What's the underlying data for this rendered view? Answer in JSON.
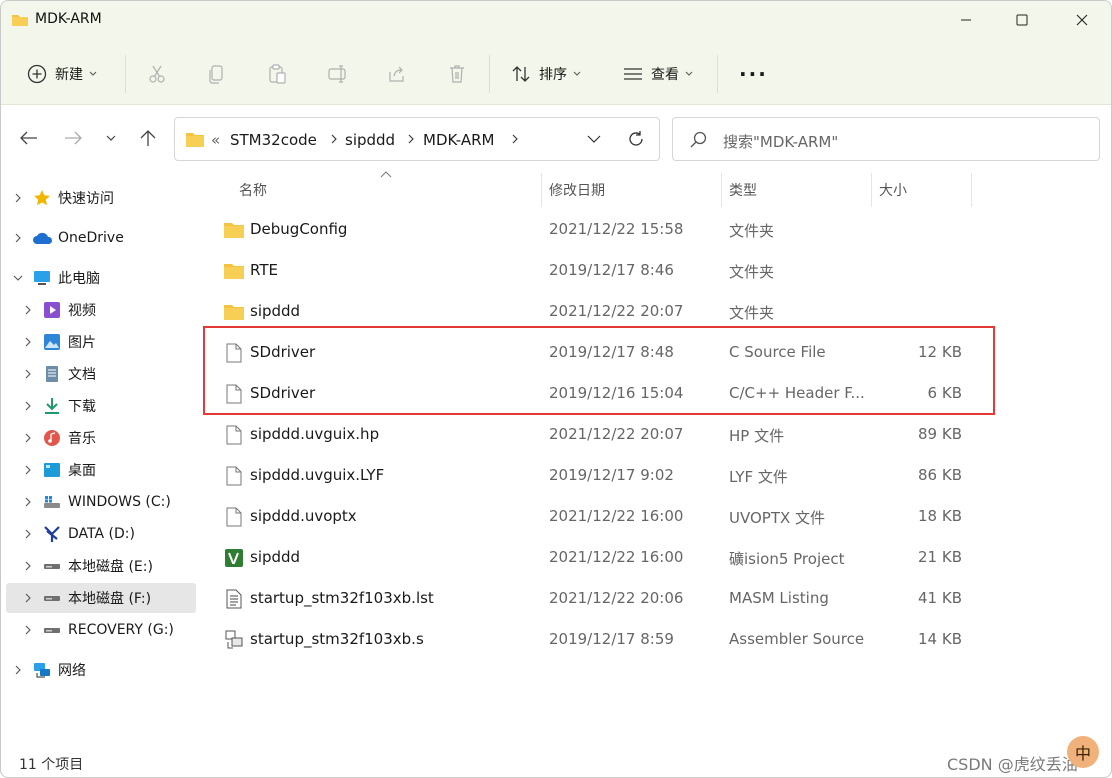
{
  "window": {
    "title": "MDK-ARM"
  },
  "commandbar": {
    "new_label": "新建",
    "sort_label": "排序",
    "view_label": "查看",
    "more_label": "..."
  },
  "address": {
    "prefix": "«",
    "crumbs": [
      "STM32code",
      "sipddd",
      "MDK-ARM"
    ]
  },
  "search": {
    "placeholder": "搜索\"MDK-ARM\""
  },
  "sidebar": {
    "items": [
      {
        "label": "快速访问",
        "icon": "star-icon"
      },
      {
        "label": "OneDrive",
        "icon": "cloud-icon"
      },
      {
        "label": "此电脑",
        "icon": "computer-icon"
      },
      {
        "label": "视频",
        "icon": "video-icon"
      },
      {
        "label": "图片",
        "icon": "pictures-icon"
      },
      {
        "label": "文档",
        "icon": "documents-icon"
      },
      {
        "label": "下载",
        "icon": "download-icon"
      },
      {
        "label": "音乐",
        "icon": "music-icon"
      },
      {
        "label": "桌面",
        "icon": "desktop-icon"
      },
      {
        "label": "WINDOWS (C:)",
        "icon": "windows-drive-icon"
      },
      {
        "label": "DATA (D:)",
        "icon": "data-drive-icon"
      },
      {
        "label": "本地磁盘 (E:)",
        "icon": "drive-icon"
      },
      {
        "label": "本地磁盘 (F:)",
        "icon": "drive-icon"
      },
      {
        "label": "RECOVERY (G:)",
        "icon": "drive-icon"
      },
      {
        "label": "网络",
        "icon": "network-icon"
      }
    ]
  },
  "columns": {
    "name": "名称",
    "date": "修改日期",
    "type": "类型",
    "size": "大小"
  },
  "files": [
    {
      "name": "DebugConfig",
      "date": "2021/12/22 15:58",
      "type": "文件夹",
      "size": "",
      "icon": "folder-icon"
    },
    {
      "name": "RTE",
      "date": "2019/12/17 8:46",
      "type": "文件夹",
      "size": "",
      "icon": "folder-icon"
    },
    {
      "name": "sipddd",
      "date": "2021/12/22 20:07",
      "type": "文件夹",
      "size": "",
      "icon": "folder-icon"
    },
    {
      "name": "SDdriver",
      "date": "2019/12/17 8:48",
      "type": "C Source File",
      "size": "12 KB",
      "icon": "file-icon"
    },
    {
      "name": "SDdriver",
      "date": "2019/12/16 15:04",
      "type": "C/C++ Header F...",
      "size": "6 KB",
      "icon": "file-icon"
    },
    {
      "name": "sipddd.uvguix.hp",
      "date": "2021/12/22 20:07",
      "type": "HP 文件",
      "size": "89 KB",
      "icon": "file-icon"
    },
    {
      "name": "sipddd.uvguix.LYF",
      "date": "2019/12/17 9:02",
      "type": "LYF 文件",
      "size": "86 KB",
      "icon": "file-icon"
    },
    {
      "name": "sipddd.uvoptx",
      "date": "2021/12/22 16:00",
      "type": "UVOPTX 文件",
      "size": "18 KB",
      "icon": "file-icon"
    },
    {
      "name": "sipddd",
      "date": "2021/12/22 16:00",
      "type": "礦ision5 Project",
      "size": "21 KB",
      "icon": "uvision-project-icon"
    },
    {
      "name": "startup_stm32f103xb.lst",
      "date": "2021/12/22 20:06",
      "type": "MASM Listing",
      "size": "41 KB",
      "icon": "listing-file-icon"
    },
    {
      "name": "startup_stm32f103xb.s",
      "date": "2019/12/17 8:59",
      "type": "Assembler Source",
      "size": "14 KB",
      "icon": "assembler-file-icon"
    }
  ],
  "status": {
    "item_count": "11 个项目"
  },
  "watermark": "CSDN @虎纹丢油",
  "ime": "中"
}
